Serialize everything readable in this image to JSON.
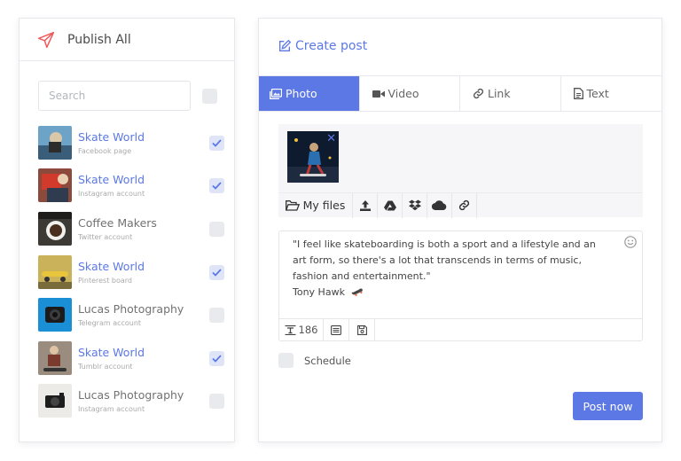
{
  "publish_panel": {
    "title": "Publish All",
    "search_placeholder": "Search",
    "accounts": [
      {
        "name": "Skate World",
        "type": "Facebook page",
        "checked": true,
        "highlight": true
      },
      {
        "name": "Skate World",
        "type": "Instagram account",
        "checked": true,
        "highlight": true
      },
      {
        "name": "Coffee Makers",
        "type": "Twitter account",
        "checked": false,
        "highlight": false
      },
      {
        "name": "Skate World",
        "type": "Pinterest board",
        "checked": true,
        "highlight": true
      },
      {
        "name": "Lucas Photography",
        "type": "Telegram account",
        "checked": false,
        "highlight": false
      },
      {
        "name": "Skate World",
        "type": "Tumblr account",
        "checked": true,
        "highlight": true
      },
      {
        "name": "Lucas Photography",
        "type": "Instagram account",
        "checked": false,
        "highlight": false
      }
    ]
  },
  "create_post": {
    "title": "Create post",
    "tabs": [
      {
        "label": "Photo",
        "icon": "photo-icon",
        "active": true
      },
      {
        "label": "Video",
        "icon": "video-icon",
        "active": false
      },
      {
        "label": "Link",
        "icon": "link-icon",
        "active": false
      },
      {
        "label": "Text",
        "icon": "text-file-icon",
        "active": false
      }
    ],
    "media_remove": "✕",
    "sources": {
      "my_files_label": "My files",
      "icons": [
        "upload-icon",
        "google-drive-icon",
        "dropbox-icon",
        "cloud-icon",
        "link-icon"
      ]
    },
    "caption": {
      "text": "\"I feel like skateboarding is both a sport and a lifestyle and an art form, so there's a lot that transcends in terms of music, fashion and entertainment.\"",
      "author": "Tony Hawk",
      "emoji": "🛹",
      "char_count": "186"
    },
    "schedule_label": "Schedule",
    "post_button": "Post now"
  },
  "colors": {
    "accent": "#5b78e5",
    "panel_border": "#e6e8ee",
    "muted_text": "#aaaaaa"
  }
}
